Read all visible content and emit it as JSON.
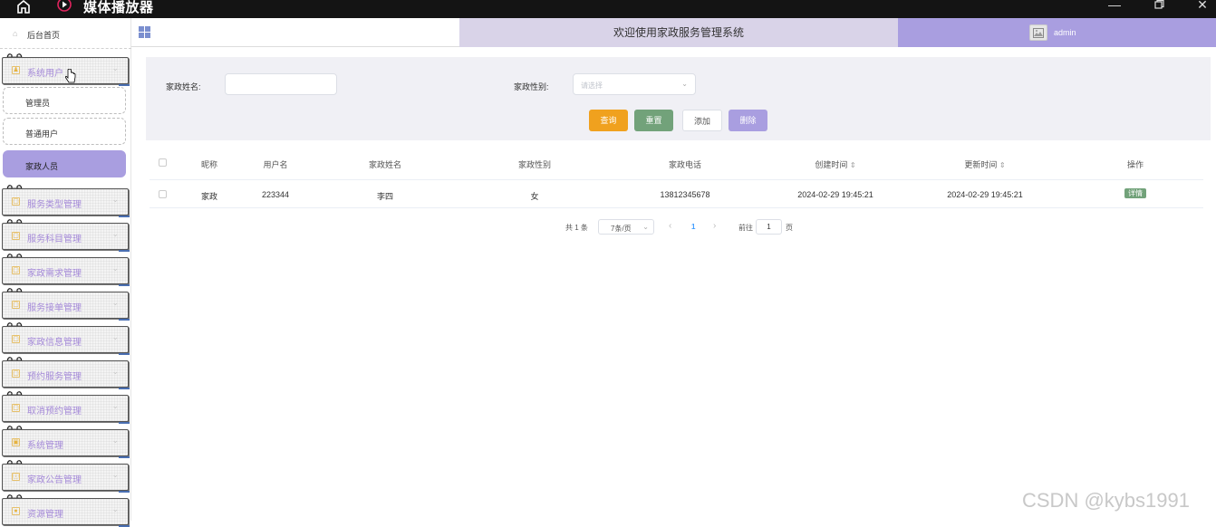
{
  "window": {
    "title": "媒体播放器"
  },
  "sidebar": {
    "home": "后台首页",
    "categories": [
      {
        "label": "系统用户",
        "icon": "person-icon"
      },
      {
        "label": "服务类型管理",
        "icon": "document-icon"
      },
      {
        "label": "服务科目管理",
        "icon": "document-icon"
      },
      {
        "label": "家政需求管理",
        "icon": "document-icon"
      },
      {
        "label": "服务接单管理",
        "icon": "document-icon"
      },
      {
        "label": "家政信息管理",
        "icon": "document-icon"
      },
      {
        "label": "预约服务管理",
        "icon": "document-icon"
      },
      {
        "label": "取消预约管理",
        "icon": "document-icon"
      },
      {
        "label": "系统管理",
        "icon": "image-icon"
      },
      {
        "label": "家政公告管理",
        "icon": "info-icon"
      },
      {
        "label": "资源管理",
        "icon": "dot-icon"
      }
    ],
    "sub_items": [
      {
        "label": "管理员"
      },
      {
        "label": "普通用户"
      },
      {
        "label": "家政人员"
      }
    ]
  },
  "header": {
    "welcome": "欢迎使用家政服务管理系统",
    "username": "admin"
  },
  "search": {
    "name_label": "家政姓名:",
    "gender_label": "家政性别:",
    "gender_placeholder": "请选择",
    "btn_search": "查询",
    "btn_reset": "重置",
    "btn_add": "添加",
    "btn_delete": "删除"
  },
  "table": {
    "headers": [
      "昵称",
      "用户名",
      "家政姓名",
      "家政性别",
      "家政电话",
      "创建时间",
      "更新时间",
      "操作"
    ],
    "rows": [
      {
        "nickname": "家政",
        "username": "223344",
        "name": "李四",
        "gender": "女",
        "phone": "13812345678",
        "created": "2024-02-29 19:45:21",
        "updated": "2024-02-29 19:45:21",
        "action": "详情"
      }
    ]
  },
  "pagination": {
    "total": "共 1 条",
    "page_size": "7条/页",
    "prev": "‹",
    "current": "1",
    "next": "›",
    "goto_label": "前往",
    "goto_value": "1",
    "page_suffix": "页"
  },
  "watermark": "CSDN @kybs1991",
  "colors": {
    "accent": "#a99ee0",
    "search_btn": "#f0a11e",
    "reset_btn": "#72a27a",
    "header_mid": "#d9d3e8"
  }
}
